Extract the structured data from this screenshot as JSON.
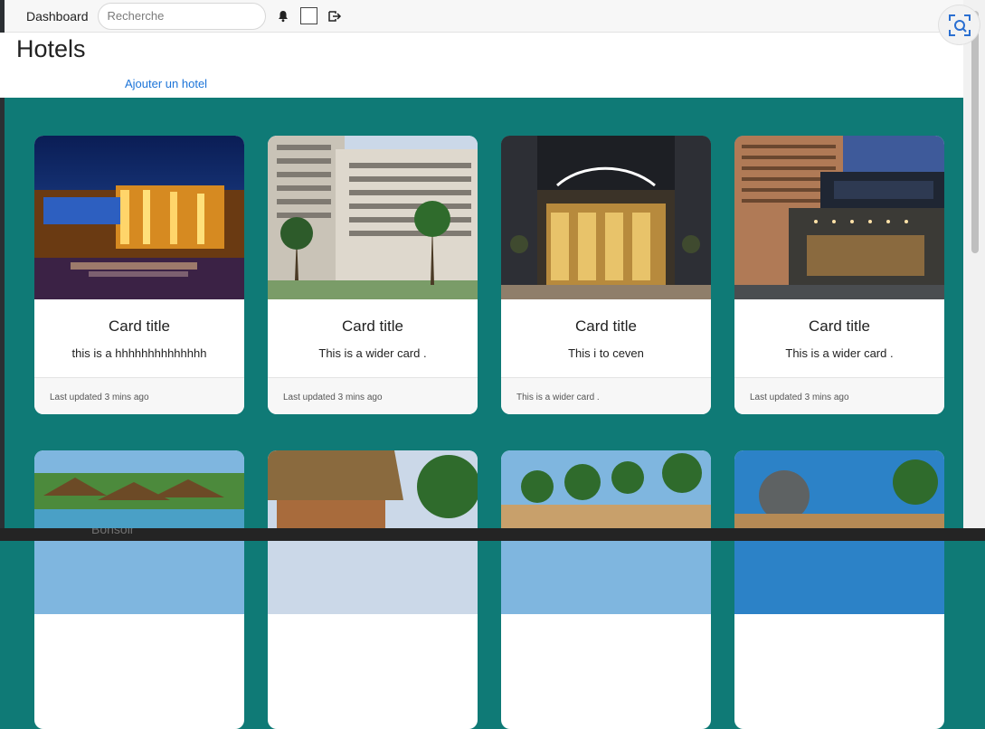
{
  "topbar": {
    "dashboard_label": "Dashboard",
    "search": {
      "placeholder": "Recherche"
    }
  },
  "page": {
    "title": "Hotels",
    "add_link": "Ajouter un hotel"
  },
  "cards": [
    {
      "title": "Card title",
      "text": "this is a hhhhhhhhhhhhhh",
      "footer": "Last updated 3 mins ago"
    },
    {
      "title": "Card title",
      "text": "This is a wider card .",
      "footer": "Last updated 3 mins ago"
    },
    {
      "title": "Card title",
      "text": "This i to ceven",
      "footer": "This is a wider card ."
    },
    {
      "title": "Card title",
      "text": "This is a wider card .",
      "footer": "Last updated 3 mins ago"
    }
  ],
  "taskbar": {
    "text": "Bonsoir"
  },
  "colors": {
    "background": "#0f7a76",
    "link": "#1c74d8",
    "card_bg": "#ffffff",
    "footer_bg": "#f7f7f7"
  },
  "icons": {
    "bell": "bell-icon",
    "checkbox": "checkbox",
    "logout": "logout-icon",
    "capture": "screen-capture-icon"
  }
}
